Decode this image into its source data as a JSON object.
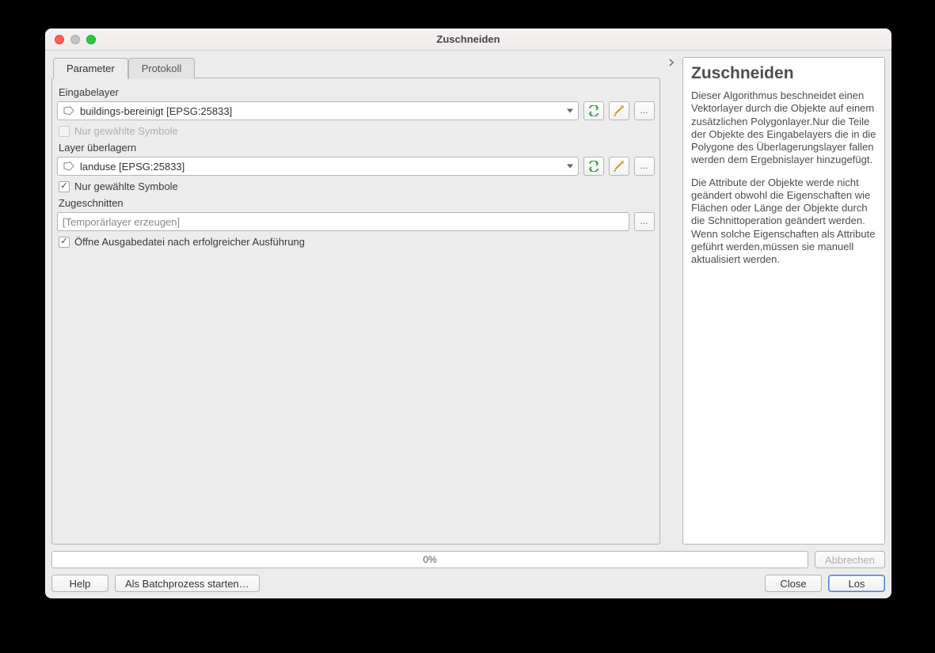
{
  "window": {
    "title": "Zuschneiden"
  },
  "tabs": {
    "parameter": "Parameter",
    "protokoll": "Protokoll"
  },
  "input_layer": {
    "label": "Eingabelayer",
    "value": "buildings-bereinigt [EPSG:25833]",
    "only_selected_label": "Nur gewählte Symbole",
    "only_selected_checked": false,
    "only_selected_disabled": true
  },
  "overlay_layer": {
    "label": "Layer überlagern",
    "value": "landuse [EPSG:25833]",
    "only_selected_label": "Nur gewählte Symbole",
    "only_selected_checked": true
  },
  "output": {
    "label": "Zugeschnitten",
    "placeholder": "[Temporärlayer erzeugen]",
    "open_after_label": "Öffne Ausgabedatei nach erfolgreicher Ausführung",
    "open_after_checked": true
  },
  "help": {
    "title": "Zuschneiden",
    "p1": "Dieser Algorithmus beschneidet einen Vektorlayer durch die Objekte auf einem zusätzlichen Polygonlayer.Nur die Teile der Objekte des Eingabelayers die in die Polygone des Überlagerungslayer fallen werden dem Ergebnislayer hinzugefügt.",
    "p2": "Die Attribute der Objekte werde nicht geändert obwohl die Eigenschaften wie Flächen oder Länge der Objekte durch die Schnittoperation geändert werden. Wenn solche Eigenschaften als Attribute geführt werden,müssen sie manuell aktualisiert werden."
  },
  "progress": {
    "text": "0%"
  },
  "buttons": {
    "cancel": "Abbrechen",
    "help": "Help",
    "batch": "Als Batchprozess starten…",
    "close": "Close",
    "run": "Los"
  }
}
